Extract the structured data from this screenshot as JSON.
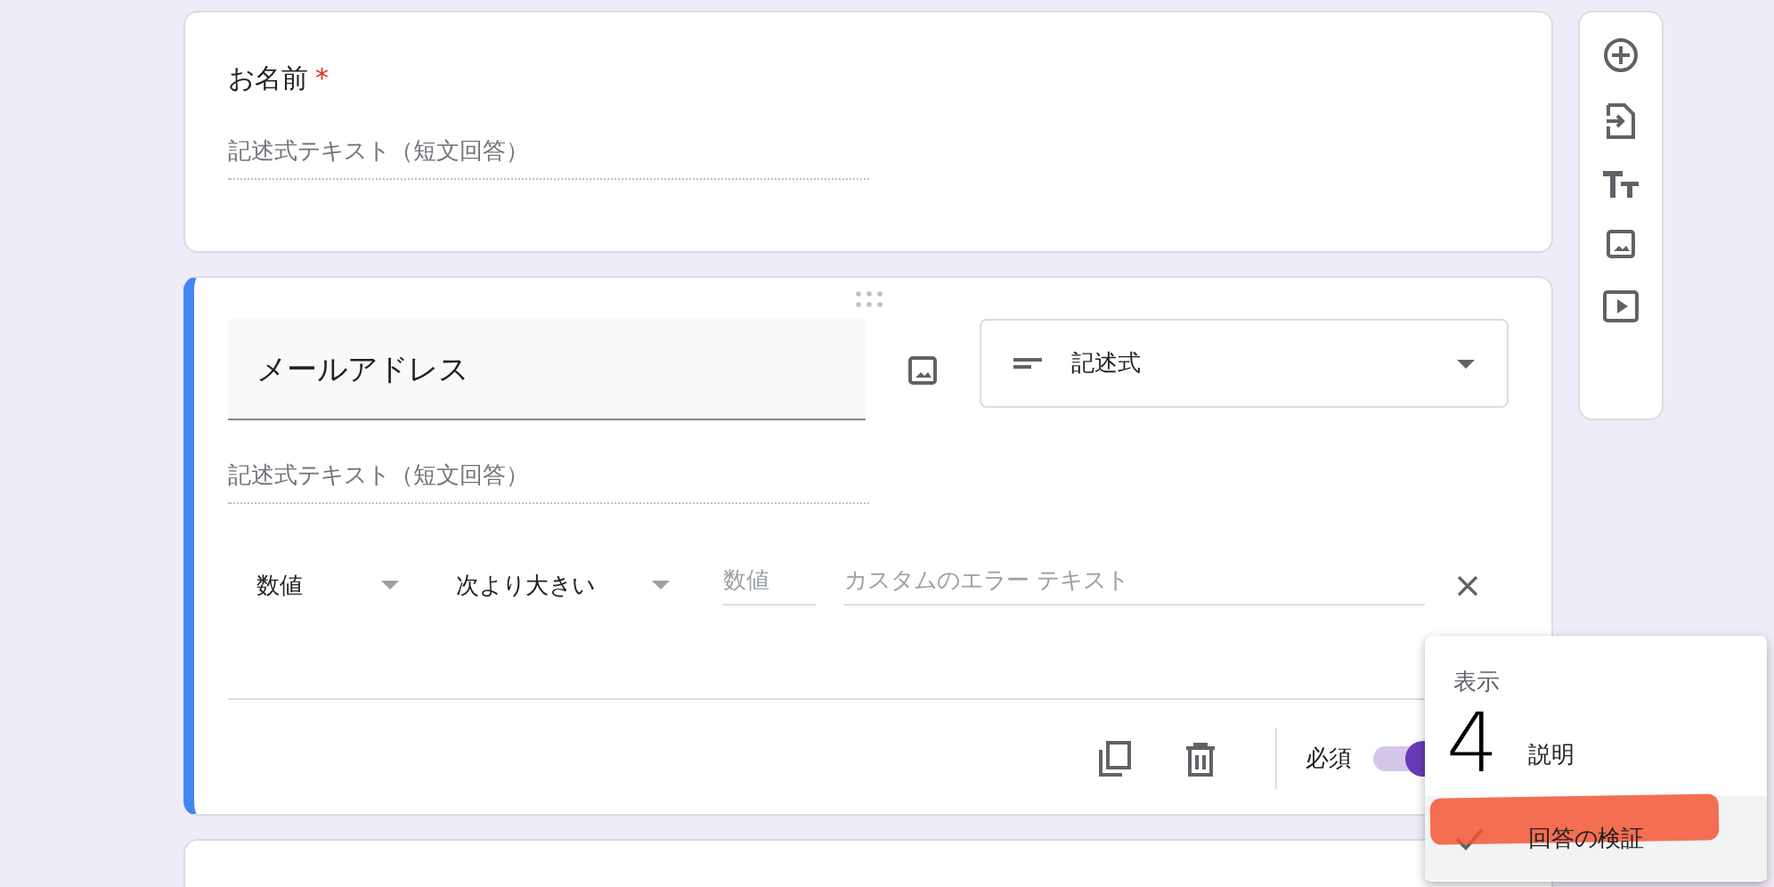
{
  "questions": [
    {
      "title": "お名前",
      "required": true,
      "required_mark": "*",
      "answer_placeholder": "記述式テキスト（短文回答）"
    }
  ],
  "active_question": {
    "title": "メールアドレス",
    "type": "記述式",
    "answer_placeholder": "記述式テキスト（短文回答）",
    "validation": {
      "category": "数値",
      "condition": "次より大きい",
      "value_placeholder": "数値",
      "error_placeholder": "カスタムのエラー テキスト"
    },
    "required_label": "必須",
    "required": true
  },
  "menu": {
    "header": "表示",
    "items": [
      {
        "label": "説明",
        "checked": false
      },
      {
        "label": "回答の検証",
        "checked": true
      }
    ]
  },
  "annotation": {
    "text": "4"
  }
}
